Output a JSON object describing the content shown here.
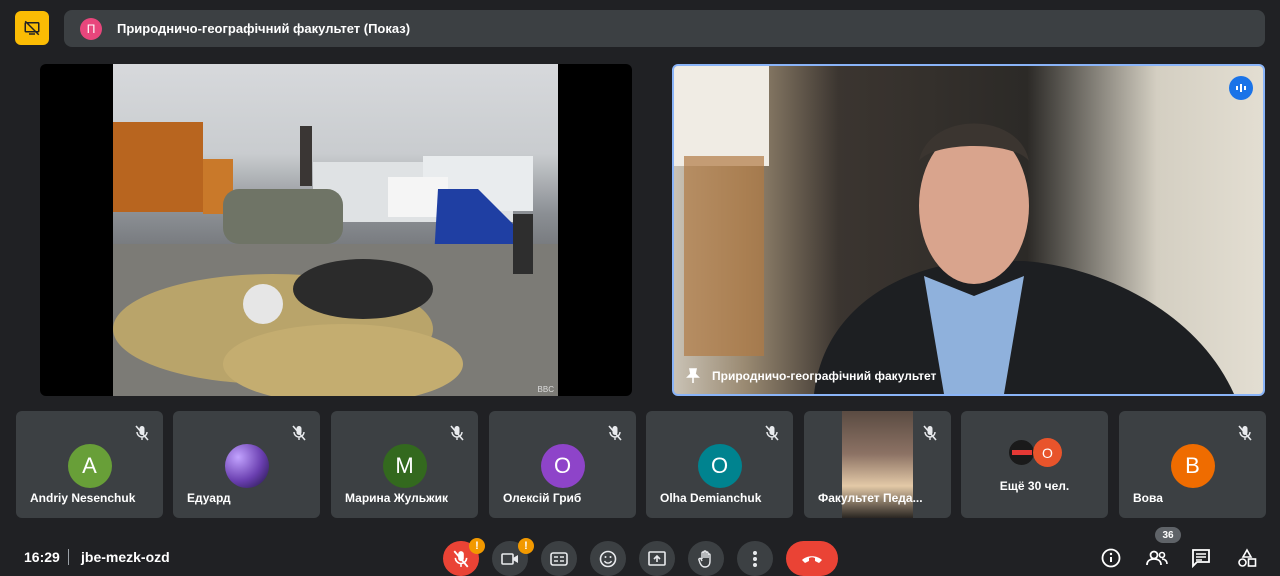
{
  "header": {
    "presenter_initial": "П",
    "presenter_title": "Природничо-географічний факультет (Показ)"
  },
  "presentation": {
    "credit": "BBC"
  },
  "speaker": {
    "name": "Природничо-географічний факультет"
  },
  "participants": [
    {
      "initial": "A",
      "name": "Andriy Nesenchuk",
      "color": "#689f38"
    },
    {
      "initial": "",
      "name": "Едуард",
      "color": "#6a3fb0"
    },
    {
      "initial": "M",
      "name": "Марина Жульжик",
      "color": "#33691e"
    },
    {
      "initial": "O",
      "name": "Олексій Гриб",
      "color": "#8e44c9"
    },
    {
      "initial": "O",
      "name": "Olha Demianchuk",
      "color": "#00838f"
    },
    {
      "initial": "",
      "name": "Факультет Педа...",
      "color": ""
    },
    {
      "initial": "О",
      "name": "Ещё 30 чел.",
      "color": "#e8542b"
    },
    {
      "initial": "B",
      "name": "Вова",
      "color": "#ef6c00"
    }
  ],
  "footer": {
    "time": "16:29",
    "meeting_code": "jbe-mezk-ozd",
    "participant_count": "36",
    "mic_warning": "!",
    "camera_warning": "!"
  }
}
